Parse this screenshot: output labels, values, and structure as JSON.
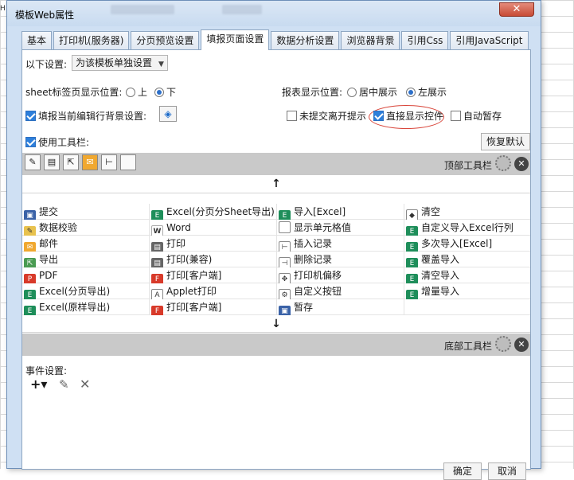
{
  "app": {
    "window_title": "模板Web属性",
    "close_symbol": "✕",
    "bg_mark": "H"
  },
  "tabs": [
    {
      "label": "基本"
    },
    {
      "label": "打印机(服务器)"
    },
    {
      "label": "分页预览设置"
    },
    {
      "label": "填报页面设置",
      "active": true
    },
    {
      "label": "数据分析设置"
    },
    {
      "label": "浏览器背景"
    },
    {
      "label": "引用Css"
    },
    {
      "label": "引用JavaScript"
    }
  ],
  "settings": {
    "scope_label": "以下设置:",
    "scope_value": "为该模板单独设置",
    "sheet_tab_label": "sheet标签页显示位置:",
    "sheet_opt_top": "上",
    "sheet_opt_bottom": "下",
    "report_pos_label": "报表显示位置:",
    "report_opt_center": "居中展示",
    "report_opt_left": "左展示",
    "fill_bg_label": "填报当前编辑行背景设置:",
    "unsubmitted_label": "未提交离开提示",
    "direct_show_label": "直接显示控件",
    "auto_save_label": "自动暂存",
    "use_toolbar_label": "使用工具栏:",
    "restore_default_label": "恢复默认"
  },
  "toolbars": {
    "top_label": "顶部工具栏",
    "bottom_label": "底部工具栏",
    "up_arrow": "↑",
    "down_arrow": "↓"
  },
  "tools": [
    [
      "提交",
      "Excel(分页分Sheet导出)",
      "导入[Excel]",
      "清空"
    ],
    [
      "数据校验",
      "Word",
      "显示单元格值",
      "自定义导入Excel行列"
    ],
    [
      "邮件",
      "打印",
      "插入记录",
      "多次导入[Excel]"
    ],
    [
      "导出",
      "打印(兼容)",
      "删除记录",
      "覆盖导入"
    ],
    [
      "PDF",
      "打印[客户端]",
      "打印机偏移",
      "清空导入"
    ],
    [
      "Excel(分页导出)",
      "Applet打印",
      "自定义按钮",
      "增量导入"
    ],
    [
      "Excel(原样导出)",
      "打印[客户端]",
      "暂存",
      ""
    ]
  ],
  "events": {
    "label": "事件设置:",
    "add": "+▾",
    "edit": "✎",
    "delete": "✕"
  },
  "footer": {
    "ok_label": "确定",
    "cancel_label": "取消"
  }
}
